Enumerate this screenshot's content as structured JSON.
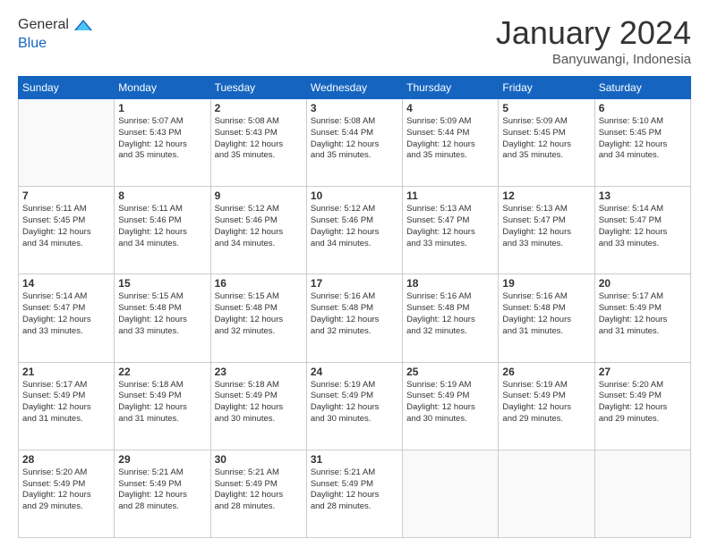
{
  "logo": {
    "line1": "General",
    "line2": "Blue"
  },
  "title": "January 2024",
  "subtitle": "Banyuwangi, Indonesia",
  "weekdays": [
    "Sunday",
    "Monday",
    "Tuesday",
    "Wednesday",
    "Thursday",
    "Friday",
    "Saturday"
  ],
  "weeks": [
    [
      {
        "day": "",
        "info": ""
      },
      {
        "day": "1",
        "info": "Sunrise: 5:07 AM\nSunset: 5:43 PM\nDaylight: 12 hours\nand 35 minutes."
      },
      {
        "day": "2",
        "info": "Sunrise: 5:08 AM\nSunset: 5:43 PM\nDaylight: 12 hours\nand 35 minutes."
      },
      {
        "day": "3",
        "info": "Sunrise: 5:08 AM\nSunset: 5:44 PM\nDaylight: 12 hours\nand 35 minutes."
      },
      {
        "day": "4",
        "info": "Sunrise: 5:09 AM\nSunset: 5:44 PM\nDaylight: 12 hours\nand 35 minutes."
      },
      {
        "day": "5",
        "info": "Sunrise: 5:09 AM\nSunset: 5:45 PM\nDaylight: 12 hours\nand 35 minutes."
      },
      {
        "day": "6",
        "info": "Sunrise: 5:10 AM\nSunset: 5:45 PM\nDaylight: 12 hours\nand 34 minutes."
      }
    ],
    [
      {
        "day": "7",
        "info": "Sunrise: 5:11 AM\nSunset: 5:45 PM\nDaylight: 12 hours\nand 34 minutes."
      },
      {
        "day": "8",
        "info": "Sunrise: 5:11 AM\nSunset: 5:46 PM\nDaylight: 12 hours\nand 34 minutes."
      },
      {
        "day": "9",
        "info": "Sunrise: 5:12 AM\nSunset: 5:46 PM\nDaylight: 12 hours\nand 34 minutes."
      },
      {
        "day": "10",
        "info": "Sunrise: 5:12 AM\nSunset: 5:46 PM\nDaylight: 12 hours\nand 34 minutes."
      },
      {
        "day": "11",
        "info": "Sunrise: 5:13 AM\nSunset: 5:47 PM\nDaylight: 12 hours\nand 33 minutes."
      },
      {
        "day": "12",
        "info": "Sunrise: 5:13 AM\nSunset: 5:47 PM\nDaylight: 12 hours\nand 33 minutes."
      },
      {
        "day": "13",
        "info": "Sunrise: 5:14 AM\nSunset: 5:47 PM\nDaylight: 12 hours\nand 33 minutes."
      }
    ],
    [
      {
        "day": "14",
        "info": "Sunrise: 5:14 AM\nSunset: 5:47 PM\nDaylight: 12 hours\nand 33 minutes."
      },
      {
        "day": "15",
        "info": "Sunrise: 5:15 AM\nSunset: 5:48 PM\nDaylight: 12 hours\nand 33 minutes."
      },
      {
        "day": "16",
        "info": "Sunrise: 5:15 AM\nSunset: 5:48 PM\nDaylight: 12 hours\nand 32 minutes."
      },
      {
        "day": "17",
        "info": "Sunrise: 5:16 AM\nSunset: 5:48 PM\nDaylight: 12 hours\nand 32 minutes."
      },
      {
        "day": "18",
        "info": "Sunrise: 5:16 AM\nSunset: 5:48 PM\nDaylight: 12 hours\nand 32 minutes."
      },
      {
        "day": "19",
        "info": "Sunrise: 5:16 AM\nSunset: 5:48 PM\nDaylight: 12 hours\nand 31 minutes."
      },
      {
        "day": "20",
        "info": "Sunrise: 5:17 AM\nSunset: 5:49 PM\nDaylight: 12 hours\nand 31 minutes."
      }
    ],
    [
      {
        "day": "21",
        "info": "Sunrise: 5:17 AM\nSunset: 5:49 PM\nDaylight: 12 hours\nand 31 minutes."
      },
      {
        "day": "22",
        "info": "Sunrise: 5:18 AM\nSunset: 5:49 PM\nDaylight: 12 hours\nand 31 minutes."
      },
      {
        "day": "23",
        "info": "Sunrise: 5:18 AM\nSunset: 5:49 PM\nDaylight: 12 hours\nand 30 minutes."
      },
      {
        "day": "24",
        "info": "Sunrise: 5:19 AM\nSunset: 5:49 PM\nDaylight: 12 hours\nand 30 minutes."
      },
      {
        "day": "25",
        "info": "Sunrise: 5:19 AM\nSunset: 5:49 PM\nDaylight: 12 hours\nand 30 minutes."
      },
      {
        "day": "26",
        "info": "Sunrise: 5:19 AM\nSunset: 5:49 PM\nDaylight: 12 hours\nand 29 minutes."
      },
      {
        "day": "27",
        "info": "Sunrise: 5:20 AM\nSunset: 5:49 PM\nDaylight: 12 hours\nand 29 minutes."
      }
    ],
    [
      {
        "day": "28",
        "info": "Sunrise: 5:20 AM\nSunset: 5:49 PM\nDaylight: 12 hours\nand 29 minutes."
      },
      {
        "day": "29",
        "info": "Sunrise: 5:21 AM\nSunset: 5:49 PM\nDaylight: 12 hours\nand 28 minutes."
      },
      {
        "day": "30",
        "info": "Sunrise: 5:21 AM\nSunset: 5:49 PM\nDaylight: 12 hours\nand 28 minutes."
      },
      {
        "day": "31",
        "info": "Sunrise: 5:21 AM\nSunset: 5:49 PM\nDaylight: 12 hours\nand 28 minutes."
      },
      {
        "day": "",
        "info": ""
      },
      {
        "day": "",
        "info": ""
      },
      {
        "day": "",
        "info": ""
      }
    ]
  ]
}
